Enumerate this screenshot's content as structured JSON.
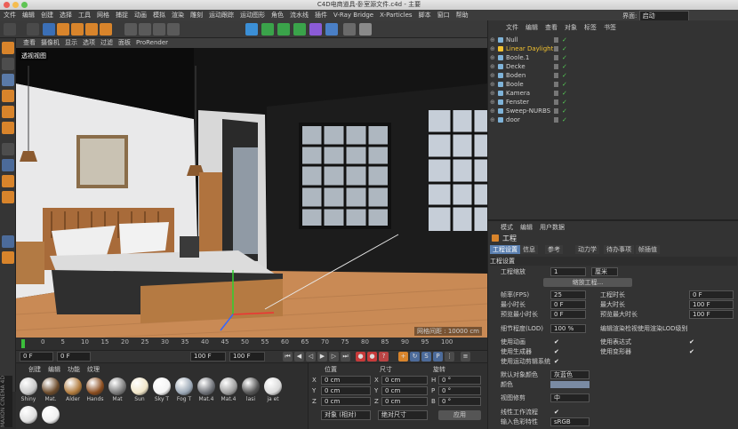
{
  "window": {
    "title": "C4D电商道具-卧室源文件.c4d - 主要",
    "layout_label": "界面:",
    "layout_value": "启动"
  },
  "menu": [
    "文件",
    "编辑",
    "创建",
    "选择",
    "工具",
    "网格",
    "捕捉",
    "动画",
    "模拟",
    "渲染",
    "雕刻",
    "运动跟踪",
    "运动图形",
    "角色",
    "流水线",
    "插件",
    "V-Ray Bridge",
    "X-Particles",
    "脚本",
    "窗口",
    "帮助"
  ],
  "toolbar": {
    "icons": [
      "undo-icon",
      "redo-icon",
      "select-icon",
      "move-icon",
      "scale-icon",
      "rotate-icon",
      "recent-icon",
      "x-axis-icon",
      "y-axis-icon",
      "z-axis-icon",
      "world-icon",
      "render-region-icon",
      "render-view-icon",
      "render-settings-icon",
      "cube-icon",
      "pen-icon",
      "subdiv-icon",
      "array-icon",
      "deformer-icon",
      "scene-icon",
      "camera-icon",
      "light-icon"
    ]
  },
  "viewport_menu": [
    "查看",
    "摄像机",
    "显示",
    "选项",
    "过滤",
    "面板",
    "ProRender"
  ],
  "viewport": {
    "tag": "透视视图",
    "scale": "网格间距 : 10000 cm"
  },
  "timeline": {
    "ticks": [
      "0",
      "5",
      "10",
      "15",
      "20",
      "25",
      "30",
      "35",
      "40",
      "45",
      "50",
      "55",
      "60",
      "65",
      "70",
      "75",
      "80",
      "85",
      "90",
      "95",
      "100"
    ],
    "current_frame": "0 F",
    "range_end": "100 F"
  },
  "transport": {
    "start": "0 F",
    "start2": "0 F",
    "end": "100 F",
    "end2": "100 F"
  },
  "material_menu": [
    "创建",
    "编辑",
    "功能",
    "纹理"
  ],
  "materials": [
    {
      "name": "Shiny",
      "color": "#c8c8c8"
    },
    {
      "name": "Mat.",
      "color": "#6b4a2a"
    },
    {
      "name": "Alder",
      "color": "#b07a3c"
    },
    {
      "name": "Hands",
      "color": "#8a4c1e"
    },
    {
      "name": "Mat",
      "color": "#7a7a7a"
    },
    {
      "name": "Sun",
      "color": "#f1e6c8"
    },
    {
      "name": "Sky T",
      "color": "#f4f4f4"
    },
    {
      "name": "Fog T",
      "color": "#9aa7b5"
    },
    {
      "name": "Mat.4",
      "color": "#6d7076"
    },
    {
      "name": "Mat.4",
      "color": "#9e9e9e"
    },
    {
      "name": "lasi",
      "color": "#555"
    },
    {
      "name": "ja et",
      "color": "#d9d9d9"
    }
  ],
  "materials_row2": [
    {
      "name": "",
      "color": "#dedede"
    },
    {
      "name": "",
      "color": "#f0f0f0"
    }
  ],
  "brand": "MAXON CINEMA 4D",
  "coords": {
    "headers": [
      "位置",
      "尺寸",
      "旋转"
    ],
    "rows": [
      {
        "axis": "X",
        "pos": "0 cm",
        "size": "0 cm",
        "rot_label": "H",
        "rot": "0 °"
      },
      {
        "axis": "Y",
        "pos": "0 cm",
        "size": "0 cm",
        "rot_label": "P",
        "rot": "0 °"
      },
      {
        "axis": "Z",
        "pos": "0 cm",
        "size": "0 cm",
        "rot_label": "B",
        "rot": "0 °"
      }
    ],
    "mode": "对象 (相对)",
    "size_mode": "绝对尺寸",
    "apply": "应用"
  },
  "objects": {
    "menu": [
      "文件",
      "编辑",
      "查看",
      "对象",
      "标签",
      "书签"
    ],
    "items": [
      {
        "name": "Null",
        "color": "#d0d0d0",
        "highlight": false,
        "indent": 0
      },
      {
        "name": "Linear Daylight",
        "color": "#f2c230",
        "highlight": true,
        "indent": 0
      },
      {
        "name": "Boole.1",
        "color": "#d0d0d0",
        "highlight": false,
        "indent": 0
      },
      {
        "name": "Decke",
        "color": "#d0d0d0",
        "highlight": false,
        "indent": 0
      },
      {
        "name": "Boden",
        "color": "#d0d0d0",
        "highlight": false,
        "indent": 0
      },
      {
        "name": "Boole",
        "color": "#d0d0d0",
        "highlight": false,
        "indent": 0
      },
      {
        "name": "Kamera",
        "color": "#d0d0d0",
        "highlight": false,
        "indent": 0
      },
      {
        "name": "Fenster",
        "color": "#d0d0d0",
        "highlight": false,
        "indent": 0
      },
      {
        "name": "Sweep-NURBS",
        "color": "#d0d0d0",
        "highlight": false,
        "indent": 0
      },
      {
        "name": "door",
        "color": "#d0d0d0",
        "highlight": false,
        "indent": 0
      }
    ]
  },
  "attributes": {
    "menu": [
      "模式",
      "编辑",
      "用户数据"
    ],
    "title": "工程",
    "tabs": [
      "工程设置",
      "信息",
      "参考",
      "动力学",
      "待办事项",
      "帧插值"
    ],
    "section": "工程设置",
    "scale_label": "工程缩放",
    "scale_value": "1",
    "scale_unit": "厘米",
    "scale_btn": "缩放工程...",
    "fps_label": "帧率(FPS)",
    "fps": "25",
    "proj_len_label": "工程时长",
    "proj_len": "0 F",
    "min_label": "最小时长",
    "min": "0 F",
    "max_label": "最大时长",
    "max": "100 F",
    "pmin_label": "预览最小时长",
    "pmin": "0 F",
    "pmax_label": "预览最大时长",
    "pmax": "100 F",
    "lod_label": "细节程度(LOD)",
    "lod": "100 %",
    "lod_check": "编辑渲染检视使用渲染LOD级别",
    "anim_label": "使用动画",
    "expr_label": "使用表达式",
    "gen_label": "使用生成器",
    "deform_label": "使用变形器",
    "motion_label": "使用运动剪辑系统",
    "obj_color_label": "默认对象颜色",
    "obj_color": "灰蓝色",
    "color_label": "颜色",
    "view_clip_label": "视图修剪",
    "view_clip": "中",
    "linear_label": "线性工作流程",
    "input_color_label": "输入色彩特性",
    "input_color": "sRGB"
  }
}
